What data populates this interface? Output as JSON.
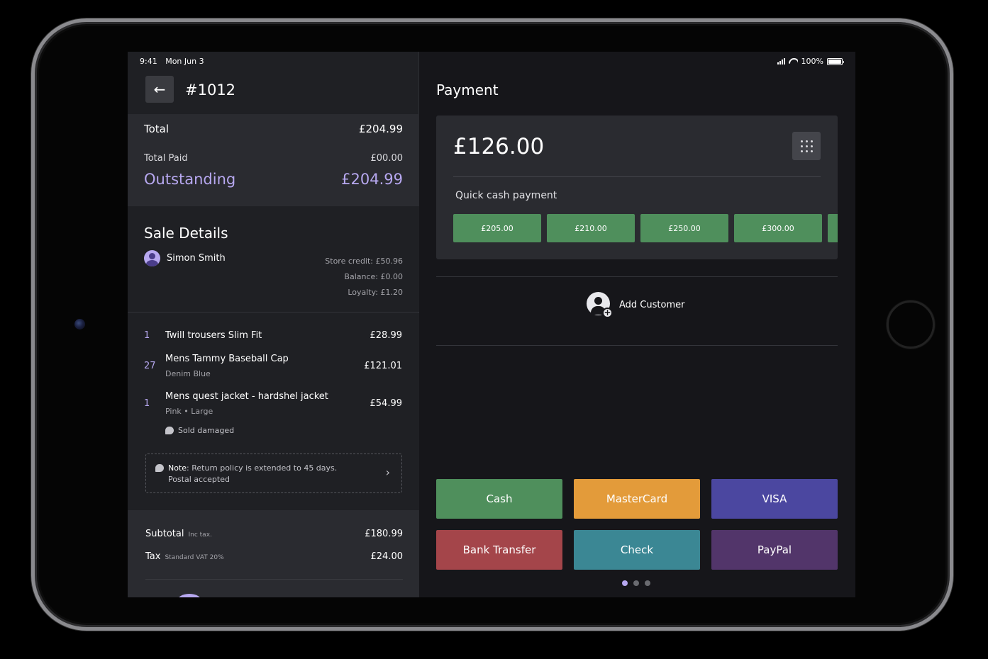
{
  "status": {
    "time": "9:41",
    "date": "Mon Jun 3",
    "battery": "100%"
  },
  "order": {
    "number": "#1012"
  },
  "summary": {
    "total_label": "Total",
    "total_value": "£204.99",
    "paid_label": "Total Paid",
    "paid_value": "£00.00",
    "outstanding_label": "Outstanding",
    "outstanding_value": "£204.99"
  },
  "sale": {
    "title": "Sale Details",
    "customer_name": "Simon Smith",
    "store_credit": "Store credit: £50.96",
    "balance": "Balance: £0.00",
    "loyalty": "Loyalty: £1.20"
  },
  "items": [
    {
      "qty": "1",
      "name": "Twill trousers Slim Fit",
      "variant": "",
      "price": "£28.99"
    },
    {
      "qty": "27",
      "name": "Mens Tammy Baseball Cap",
      "variant": "Denim Blue",
      "price": "£121.01"
    },
    {
      "qty": "1",
      "name": "Mens quest jacket - hardshel jacket",
      "variant": "Pink • Large",
      "price": "£54.99",
      "note": "Sold damaged"
    }
  ],
  "note": {
    "label": "Note",
    "text": ": Return policy is extended to 45 days.",
    "text2": "Postal accepted"
  },
  "totals": {
    "subtotal_label": "Subtotal",
    "subtotal_hint": "Inc tax.",
    "subtotal_value": "£180.99",
    "tax_label": "Tax",
    "tax_hint": "Standard VAT 20%",
    "tax_value": "£24.00"
  },
  "payment": {
    "title": "Payment",
    "amount": "£126.00",
    "quick_cash_label": "Quick cash payment",
    "quick_cash": [
      "£205.00",
      "£210.00",
      "£250.00",
      "£300.00"
    ],
    "add_customer": "Add Customer",
    "methods": [
      {
        "label": "Cash",
        "color": "#4f8f5c"
      },
      {
        "label": "MasterCard",
        "color": "#e39b3a"
      },
      {
        "label": "VISA",
        "color": "#4b47a0"
      },
      {
        "label": "Bank Transfer",
        "color": "#a4454a"
      },
      {
        "label": "Check",
        "color": "#3b8794"
      },
      {
        "label": "PayPal",
        "color": "#52356a"
      }
    ],
    "page_indicator": {
      "pages": 3,
      "current": 1
    }
  },
  "icons": {
    "back": "arrow-left-icon",
    "keypad": "keypad-icon",
    "add_customer": "add-person-icon",
    "note": "comment-icon",
    "chevron": "chevron-right-icon"
  }
}
